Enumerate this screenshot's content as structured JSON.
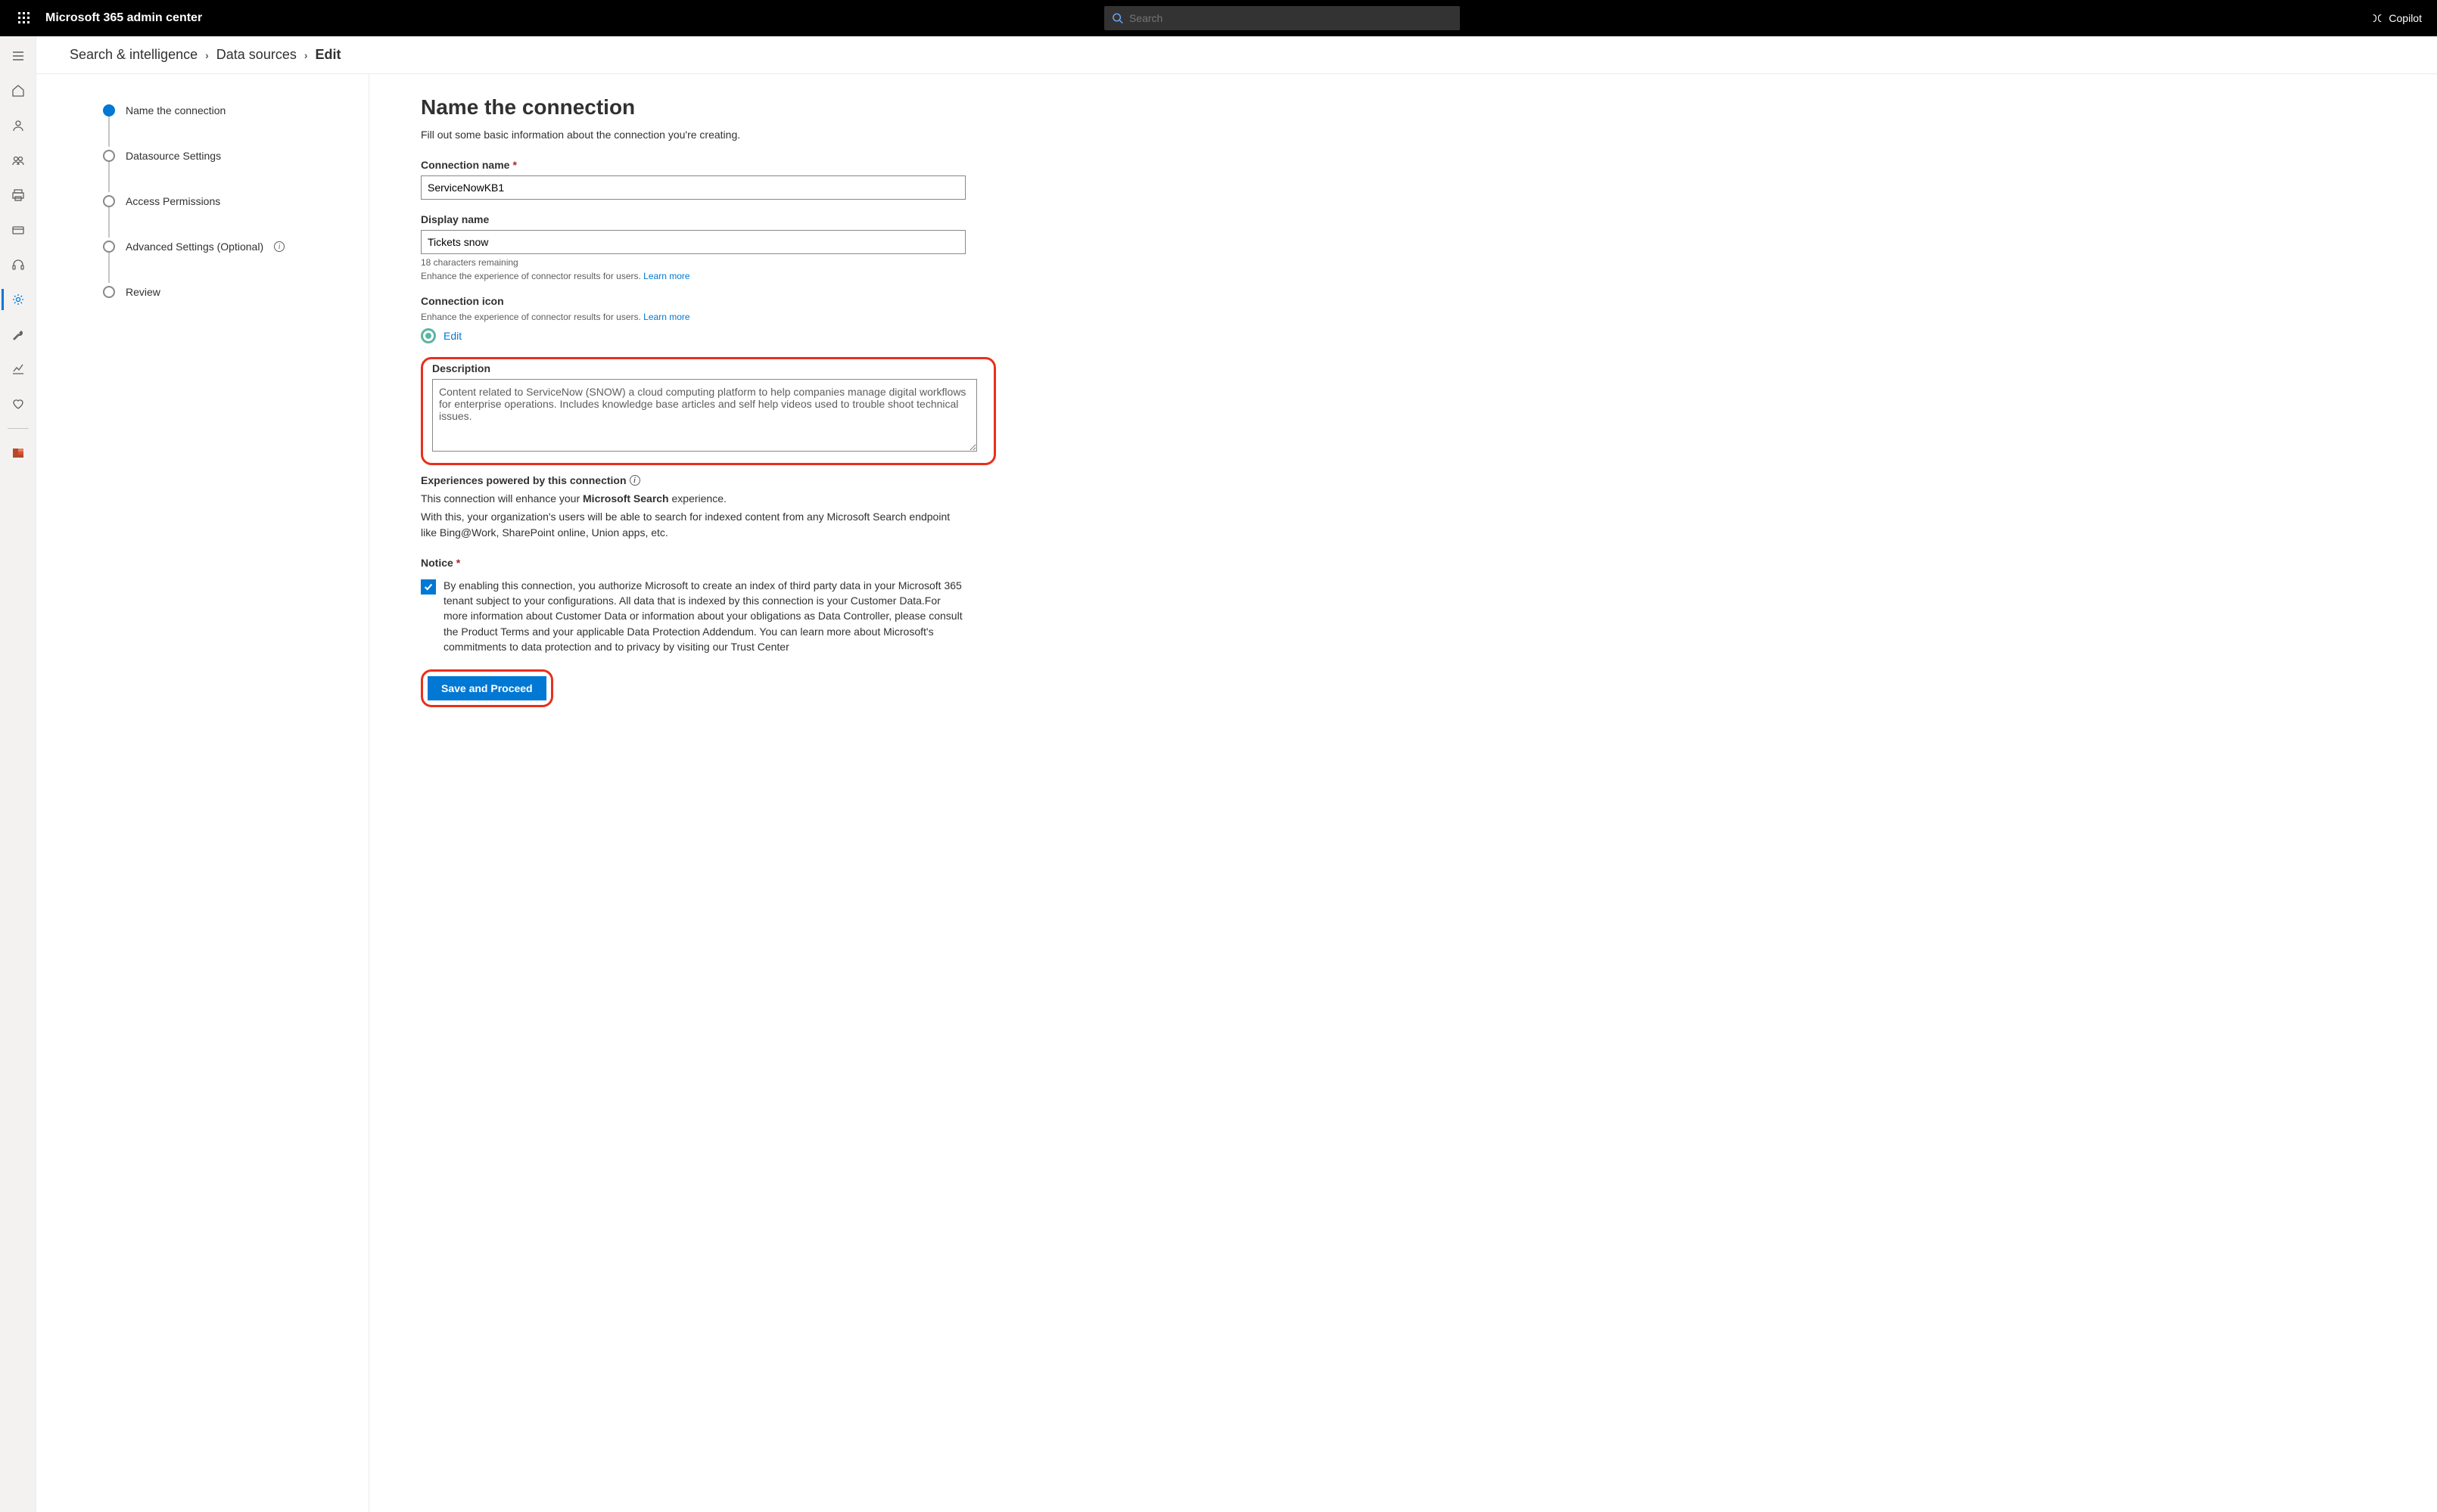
{
  "header": {
    "app_title": "Microsoft 365 admin center",
    "search_placeholder": "Search",
    "copilot_label": "Copilot"
  },
  "breadcrumb": {
    "root": "Search & intelligence",
    "section": "Data sources",
    "current": "Edit"
  },
  "steps": [
    {
      "label": "Name the connection",
      "active": true
    },
    {
      "label": "Datasource Settings",
      "active": false
    },
    {
      "label": "Access Permissions",
      "active": false
    },
    {
      "label": "Advanced Settings (Optional)",
      "active": false,
      "hasInfo": true
    },
    {
      "label": "Review",
      "active": false
    }
  ],
  "form": {
    "title": "Name the connection",
    "subtitle": "Fill out some basic information about the connection you're creating.",
    "conn_name": {
      "label": "Connection name",
      "value": "ServiceNowKB1"
    },
    "display_name": {
      "label": "Display name",
      "value": "Tickets snow",
      "chars_remaining": "18 characters remaining",
      "enhance_text": "Enhance the experience of connector results for users. ",
      "learn_more": "Learn more"
    },
    "conn_icon": {
      "label": "Connection icon",
      "enhance_text": "Enhance the experience of connector results for users. ",
      "learn_more": "Learn more",
      "edit_label": "Edit"
    },
    "description": {
      "label": "Description",
      "value": "Content related to ServiceNow (SNOW) a cloud computing platform to help companies manage digital workflows for enterprise operations. Includes knowledge base articles and self help videos used to trouble shoot technical issues."
    },
    "experiences": {
      "label": "Experiences powered by this connection",
      "line1_pre": "This connection will enhance your ",
      "line1_strong": "Microsoft Search",
      "line1_post": " experience.",
      "line2": "With this, your organization's users will be able to search for indexed content from any Microsoft Search endpoint like Bing@Work, SharePoint online, Union apps, etc."
    },
    "notice": {
      "label": "Notice",
      "text": "By enabling this connection, you authorize Microsoft to create an index of third party data in your Microsoft 365 tenant subject to your configurations. All data that is indexed by this connection is your Customer Data.For more information about Customer Data or information about your obligations as Data Controller, please consult the Product Terms and your applicable Data Protection Addendum. You can learn more about Microsoft's commitments to data protection and to privacy by visiting our Trust Center"
    },
    "save_btn": "Save and Proceed"
  }
}
